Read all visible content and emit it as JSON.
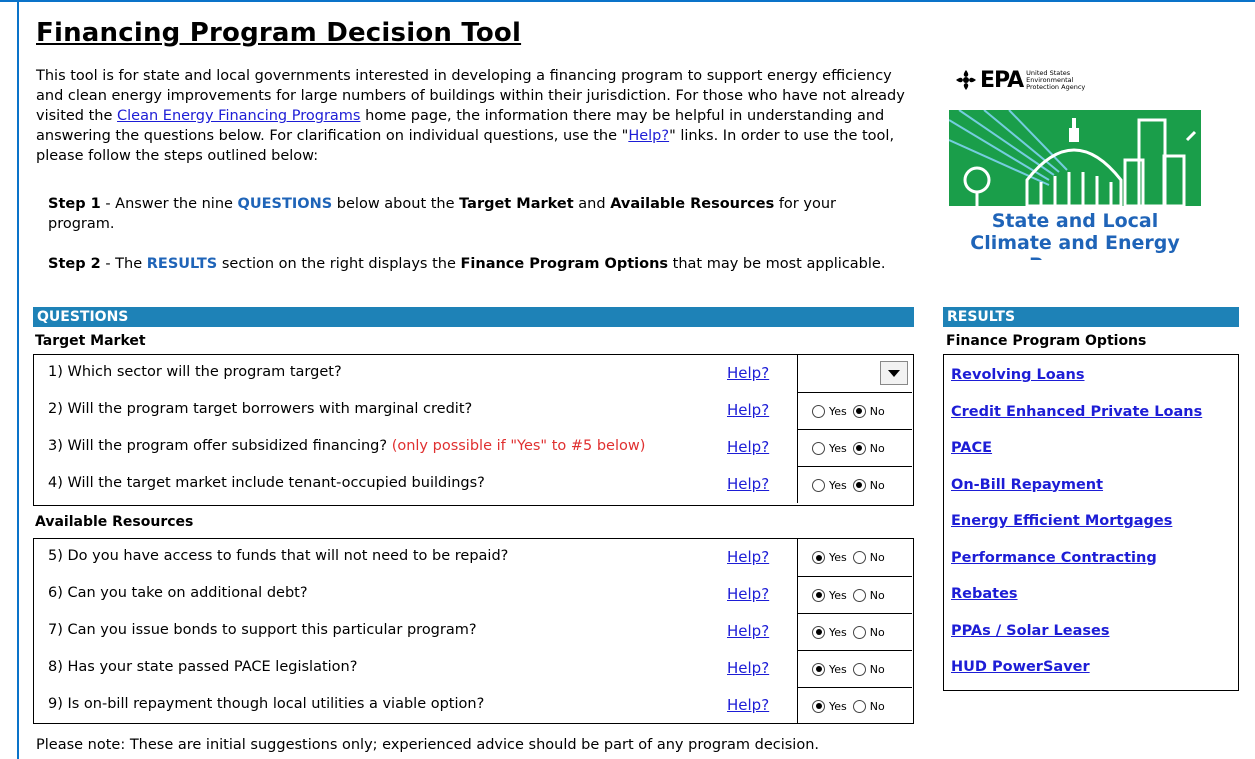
{
  "title": "Financing Program Decision Tool",
  "intro": {
    "part1": "This tool is for state and local governments interested in developing a financing program to support energy efficiency and clean energy improvements for large numbers of buildings within their jurisdiction. For those who have not already visited the ",
    "link1": "Clean Energy Financing Programs",
    "part2": " home page, the information there may be helpful in understanding and answering the questions below. For clarification on individual questions, use the  \"",
    "link2": "Help?",
    "part3": "\" links.  In order to use the tool, please follow the steps outlined below:"
  },
  "step1": {
    "label": "Step 1",
    "t1": " - Answer the nine ",
    "k1": "QUESTIONS",
    "t2": " below about the ",
    "k2": "Target Market",
    "t3": " and ",
    "k3": "Available Resources",
    "t4": " for your program."
  },
  "step2": {
    "label": "Step 2",
    "t1": " - The ",
    "k1": "RESULTS",
    "t2": " section on the right displays the ",
    "k2": "Finance Program Options",
    "t3": " that may be most applicable."
  },
  "logo": {
    "epa": "EPA",
    "epa_sub": "United States Environmental Protection Agency",
    "program_line1": "State and Local",
    "program_line2": "Climate and Energy Program",
    "banner_color": "#1a9e4a"
  },
  "questions_header": "QUESTIONS",
  "target_market_header": "Target Market",
  "available_resources_header": "Available Resources",
  "help_label": "Help?",
  "yes_label": "Yes",
  "no_label": "No",
  "questions": [
    {
      "text": "1) Which sector will the program target?",
      "note": "",
      "control": "dropdown",
      "value": ""
    },
    {
      "text": "2) Will the program target borrowers with marginal credit?",
      "note": "",
      "control": "radio",
      "value": "No"
    },
    {
      "text": "3) Will the program offer subsidized financing? ",
      "note": "(only possible if \"Yes\" to #5 below)",
      "control": "radio",
      "value": "No"
    },
    {
      "text": "4) Will the target market include tenant-occupied buildings?",
      "note": "",
      "control": "radio",
      "value": "No"
    },
    {
      "text": "5) Do you have access to funds that will not need to be repaid?",
      "note": "",
      "control": "radio",
      "value": "Yes"
    },
    {
      "text": "6) Can you take on additional debt?",
      "note": "",
      "control": "radio",
      "value": "Yes"
    },
    {
      "text": "7) Can you issue bonds to support this particular program?",
      "note": "",
      "control": "radio",
      "value": "Yes"
    },
    {
      "text": "8) Has your state passed PACE legislation?",
      "note": "",
      "control": "radio",
      "value": "Yes"
    },
    {
      "text": "9) Is on-bill repayment though local utilities a viable option?",
      "note": "",
      "control": "radio",
      "value": "Yes"
    }
  ],
  "results_header": "RESULTS",
  "results_subheader": "Finance Program Options",
  "results": [
    "Revolving Loans",
    "Credit Enhanced Private Loans",
    "PACE",
    "On-Bill Repayment",
    "Energy Efficient Mortgages",
    "Performance Contracting",
    "Rebates",
    "PPAs / Solar Leases",
    "HUD PowerSaver"
  ],
  "footnote": "Please note: These are initial suggestions only; experienced advice should be part of any program decision.",
  "colors": {
    "section_bar": "#1e82b7",
    "link": "#1d1dd6",
    "keyword": "#1f64b8",
    "note": "#e03030"
  }
}
